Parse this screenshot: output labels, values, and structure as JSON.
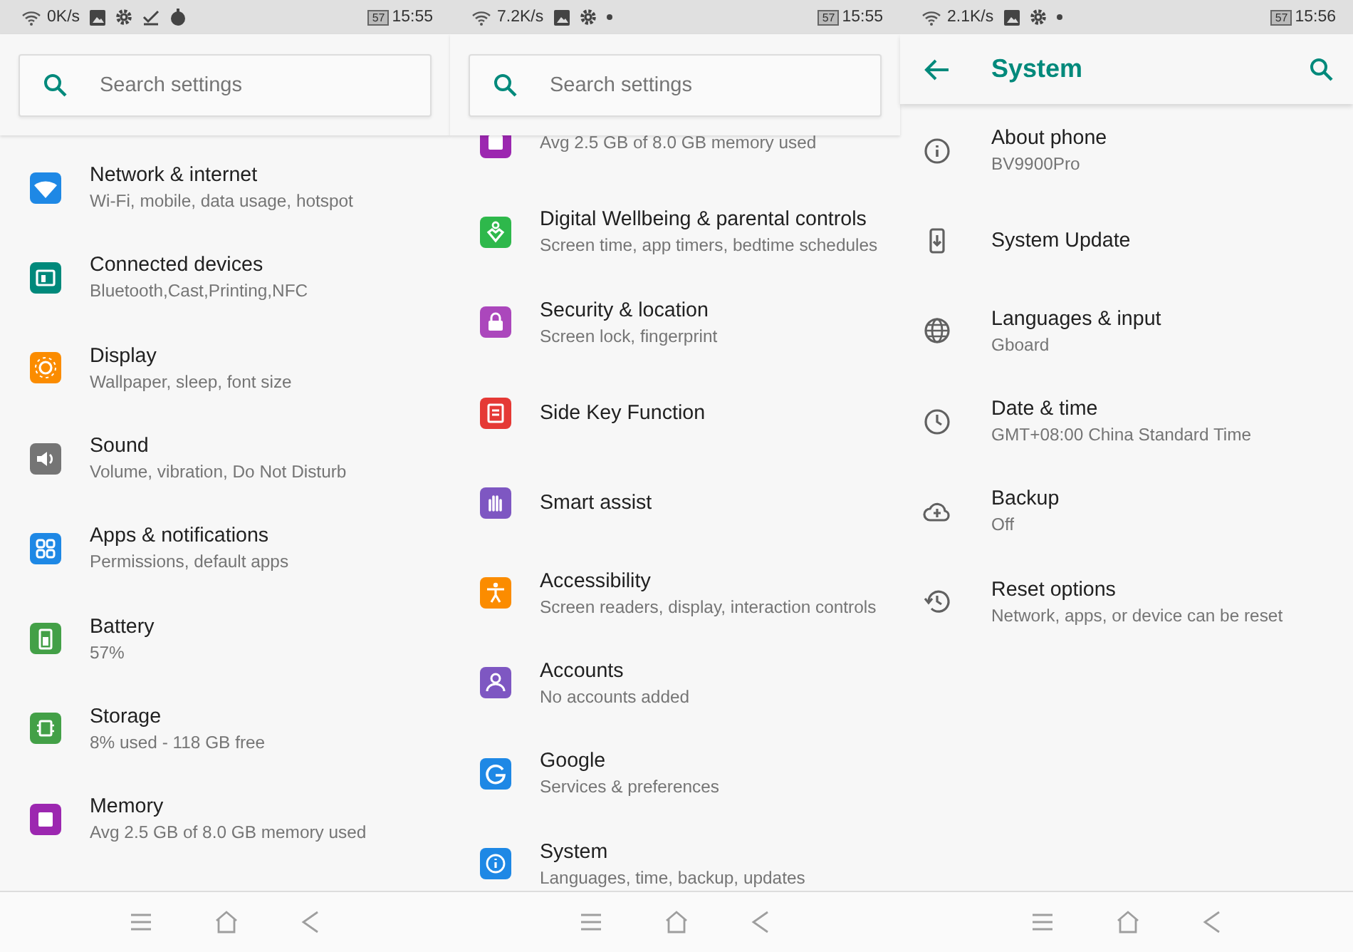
{
  "panels": [
    {
      "kind": "search",
      "status_bar": {
        "speed": "0K/s",
        "battery": "57",
        "time": "15:55"
      },
      "search": {
        "placeholder": "Search settings"
      },
      "items": [
        {
          "title": "Network & internet",
          "subtitle": "Wi-Fi, mobile, data usage, hotspot",
          "color": "#1e88e5"
        },
        {
          "title": "Connected devices",
          "subtitle": "Bluetooth,Cast,Printing,NFC",
          "color": "#00897b"
        },
        {
          "title": "Display",
          "subtitle": "Wallpaper, sleep, font size",
          "color": "#fb8c00"
        },
        {
          "title": "Sound",
          "subtitle": "Volume, vibration, Do Not Disturb",
          "color": "#757575"
        },
        {
          "title": "Apps & notifications",
          "subtitle": "Permissions, default apps",
          "color": "#1e88e5"
        },
        {
          "title": "Battery",
          "subtitle": "57%",
          "color": "#43a047"
        },
        {
          "title": "Storage",
          "subtitle": "8% used - 118 GB free",
          "color": "#43a047"
        },
        {
          "title": "Memory",
          "subtitle": "Avg 2.5 GB of 8.0 GB memory used",
          "color": "#9c27b0"
        }
      ]
    },
    {
      "kind": "search",
      "status_bar": {
        "speed": "7.2K/s",
        "battery": "57",
        "time": "15:55"
      },
      "search": {
        "placeholder": "Search settings"
      },
      "items": [
        {
          "subtitle": "Avg 2.5 GB of 8.0 GB memory used",
          "color": "#9c27b0"
        },
        {
          "title": "Digital Wellbeing & parental controls",
          "subtitle": "Screen time, app timers, bedtime schedules",
          "color": "#2eb84b"
        },
        {
          "title": "Security & location",
          "subtitle": "Screen lock, fingerprint",
          "color": "#ab47bc"
        },
        {
          "title": "Side Key Function",
          "color": "#e53935"
        },
        {
          "title": "Smart assist",
          "color": "#7e57c2"
        },
        {
          "title": "Accessibility",
          "subtitle": "Screen readers, display, interaction controls",
          "color": "#fb8c00"
        },
        {
          "title": "Accounts",
          "subtitle": "No accounts added",
          "color": "#7e57c2"
        },
        {
          "title": "Google",
          "subtitle": "Services & preferences",
          "color": "#1e88e5"
        },
        {
          "title": "System",
          "subtitle": "Languages, time, backup, updates",
          "color": "#1e88e5"
        }
      ]
    },
    {
      "kind": "subpage",
      "status_bar": {
        "speed": "2.1K/s",
        "battery": "57",
        "time": "15:56"
      },
      "app_bar": {
        "title": "System"
      },
      "items": [
        {
          "title": "About phone",
          "subtitle": "BV9900Pro"
        },
        {
          "title": "System Update"
        },
        {
          "title": "Languages & input",
          "subtitle": "Gboard"
        },
        {
          "title": "Date & time",
          "subtitle": "GMT+08:00 China Standard Time"
        },
        {
          "title": "Backup",
          "subtitle": "Off"
        },
        {
          "title": "Reset options",
          "subtitle": "Network, apps, or device can be reset"
        }
      ]
    }
  ]
}
